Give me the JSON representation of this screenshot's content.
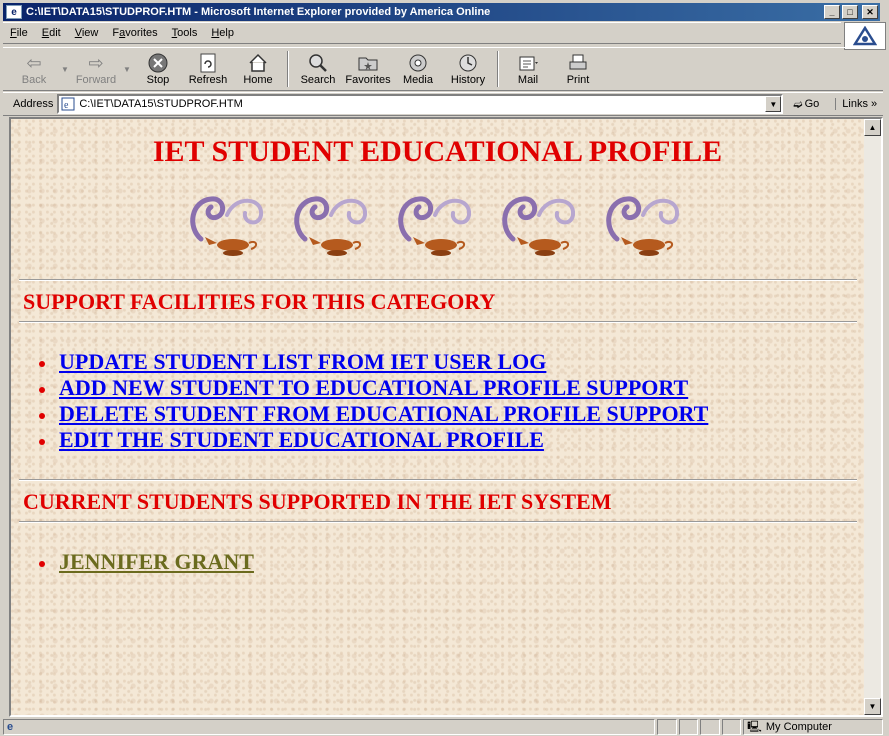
{
  "window": {
    "title": "C:\\IET\\DATA15\\STUDPROF.HTM - Microsoft Internet Explorer provided by America Online"
  },
  "menu": {
    "items": [
      "File",
      "Edit",
      "View",
      "Favorites",
      "Tools",
      "Help"
    ],
    "accelerators": [
      "F",
      "E",
      "V",
      "a",
      "T",
      "H"
    ]
  },
  "toolbar": {
    "back": "Back",
    "forward": "Forward",
    "stop": "Stop",
    "refresh": "Refresh",
    "home": "Home",
    "search": "Search",
    "favorites": "Favorites",
    "media": "Media",
    "history": "History",
    "mail": "Mail",
    "print": "Print"
  },
  "address": {
    "label": "Address",
    "value": "C:\\IET\\DATA15\\STUDPROF.HTM",
    "go": "Go",
    "links": "Links"
  },
  "page": {
    "title": "IET STUDENT EDUCATIONAL PROFILE",
    "section1": "SUPPORT FACILITIES FOR THIS CATEGORY",
    "links": [
      "UPDATE STUDENT LIST FROM IET USER LOG",
      "ADD NEW STUDENT TO EDUCATIONAL PROFILE SUPPORT",
      "DELETE STUDENT FROM EDUCATIONAL PROFILE SUPPORT",
      "EDIT THE STUDENT EDUCATIONAL PROFILE"
    ],
    "section2": "CURRENT STUDENTS SUPPORTED IN THE IET SYSTEM",
    "students": [
      "JENNIFER GRANT"
    ]
  },
  "status": {
    "zone": "My Computer"
  },
  "colors": {
    "heading": "#e00000",
    "link": "#0000ee",
    "visited_link": "#6b6b1e",
    "background": "#f4e8d6"
  }
}
